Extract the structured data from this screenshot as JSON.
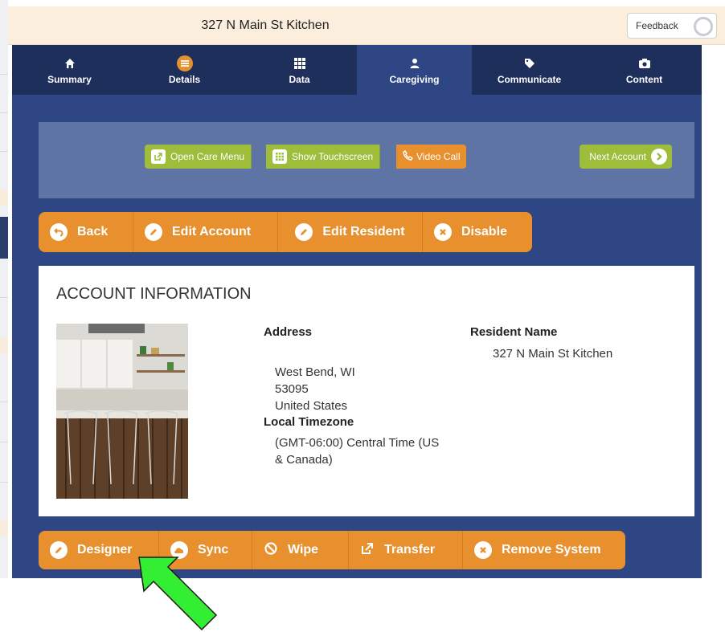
{
  "topbar": {
    "title": "327 N Main St Kitchen",
    "feedback_label": "Feedback"
  },
  "nav": {
    "tabs": [
      {
        "label": "Summary",
        "icon": "home-icon"
      },
      {
        "label": "Details",
        "icon": "list-icon"
      },
      {
        "label": "Data",
        "icon": "grid-icon"
      },
      {
        "label": "Caregiving",
        "icon": "person-icon",
        "active": true
      },
      {
        "label": "Communicate",
        "icon": "tag-icon"
      },
      {
        "label": "Content",
        "icon": "camera-icon"
      }
    ]
  },
  "care_toolbar": {
    "open_care_menu": "Open Care Menu",
    "show_touchscreen": "Show Touchscreen",
    "video_call": "Video Call",
    "next_account": "Next Account"
  },
  "account_actions": {
    "back": "Back",
    "edit_account": "Edit Account",
    "edit_resident": "Edit Resident",
    "disable": "Disable"
  },
  "account_info": {
    "heading": "ACCOUNT INFORMATION",
    "address_label": "Address",
    "address_city": "West Bend, WI",
    "address_zip": "53095",
    "address_country": "United States",
    "timezone_label": "Local Timezone",
    "timezone_line1": "(GMT-06:00) Central Time (US",
    "timezone_line2": "& Canada)",
    "resident_label": "Resident Name",
    "resident_value": "327 N Main St Kitchen"
  },
  "system_actions": {
    "designer": "Designer",
    "sync": "Sync",
    "wipe": "Wipe",
    "transfer": "Transfer",
    "remove_system": "Remove System"
  },
  "colors": {
    "panel_blue": "#2f4684",
    "nav_dark": "#1f2f5c",
    "toolbar_blue": "#5d74a5",
    "action_orange": "#e8902e",
    "action_green": "#9dbd3b",
    "pointer_green": "#33ee33"
  }
}
